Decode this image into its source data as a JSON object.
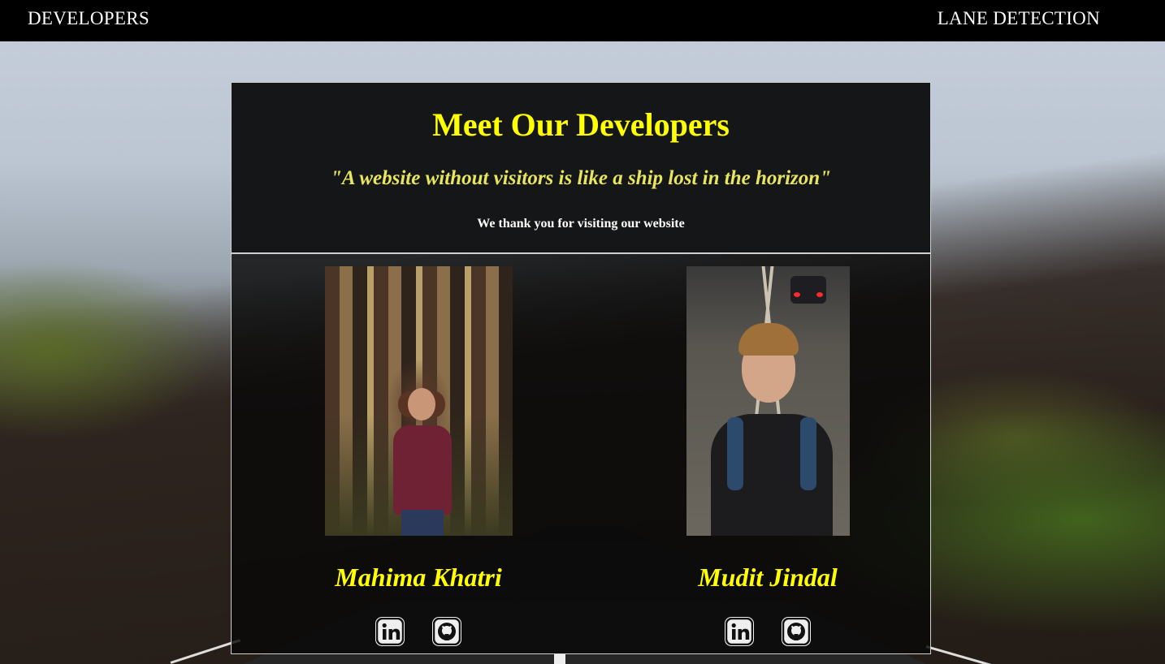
{
  "header": {
    "brand": "DEVELOPERS",
    "nav_link": "LANE DETECTION"
  },
  "intro": {
    "title": "Meet Our Developers",
    "quote": "\"A website without visitors is like a ship lost in the horizon\"",
    "thanks": "We thank you for visiting our website"
  },
  "developers": [
    {
      "name": "Mahima Khatri",
      "icons": [
        "linkedin-icon",
        "github-icon"
      ]
    },
    {
      "name": "Mudit Jindal",
      "icons": [
        "linkedin-icon",
        "github-icon"
      ]
    }
  ],
  "colors": {
    "header_bg": "#000000",
    "accent_yellow": "#ffff00",
    "quote_yellow": "#e8e65c",
    "panel_bg": "#151617"
  }
}
